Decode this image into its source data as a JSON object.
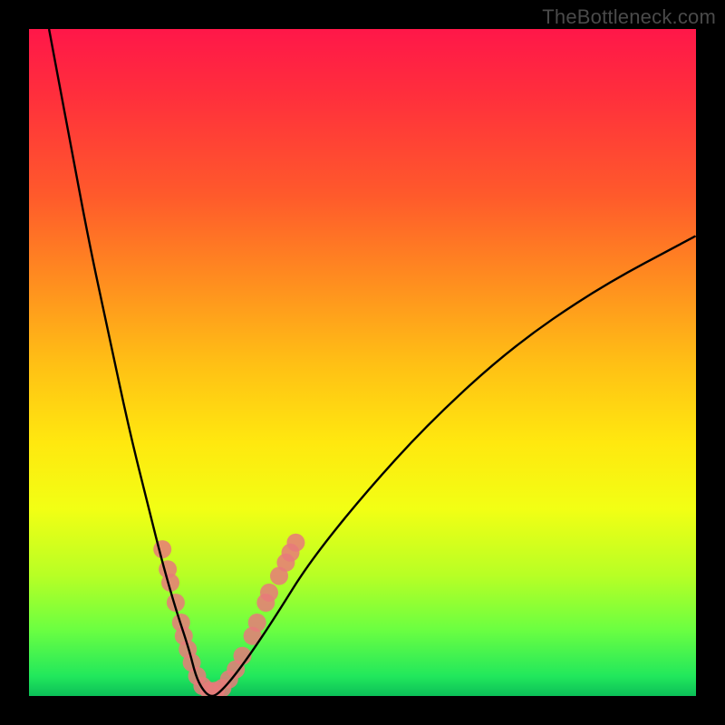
{
  "watermark": "TheBottleneck.com",
  "chart_data": {
    "type": "line",
    "title": "",
    "xlabel": "",
    "ylabel": "",
    "xlim": [
      0,
      100
    ],
    "ylim": [
      0,
      100
    ],
    "background_gradient": [
      "#ff1749",
      "#ffe80f",
      "#0bbf58"
    ],
    "series": [
      {
        "name": "bottleneck-curve",
        "color": "#000000",
        "x": [
          3,
          6,
          9,
          12,
          15,
          18,
          20,
          22,
          24,
          25,
          26,
          27,
          28,
          30,
          33,
          37,
          42,
          50,
          60,
          72,
          85,
          100
        ],
        "y": [
          100,
          84,
          68,
          54,
          40,
          28,
          20,
          13,
          7,
          3,
          1,
          0,
          0,
          2,
          6,
          12,
          20,
          30,
          41,
          52,
          61,
          69
        ]
      }
    ],
    "markers": {
      "name": "highlight-dots",
      "color": "#e77a7a",
      "radius_px": 10,
      "points": [
        {
          "x": 20.0,
          "y": 22
        },
        {
          "x": 20.8,
          "y": 19
        },
        {
          "x": 21.2,
          "y": 17
        },
        {
          "x": 22.0,
          "y": 14
        },
        {
          "x": 22.8,
          "y": 11
        },
        {
          "x": 23.2,
          "y": 9
        },
        {
          "x": 23.8,
          "y": 7
        },
        {
          "x": 24.4,
          "y": 5
        },
        {
          "x": 25.2,
          "y": 3
        },
        {
          "x": 26.0,
          "y": 1.5
        },
        {
          "x": 27.0,
          "y": 0.8
        },
        {
          "x": 28.0,
          "y": 0.8
        },
        {
          "x": 29.0,
          "y": 1.2
        },
        {
          "x": 30.0,
          "y": 2.5
        },
        {
          "x": 31.0,
          "y": 4
        },
        {
          "x": 32.0,
          "y": 6
        },
        {
          "x": 33.5,
          "y": 9
        },
        {
          "x": 34.2,
          "y": 11
        },
        {
          "x": 35.5,
          "y": 14
        },
        {
          "x": 36.0,
          "y": 15.5
        },
        {
          "x": 37.5,
          "y": 18
        },
        {
          "x": 38.5,
          "y": 20
        },
        {
          "x": 39.2,
          "y": 21.5
        },
        {
          "x": 40.0,
          "y": 23
        }
      ]
    }
  }
}
